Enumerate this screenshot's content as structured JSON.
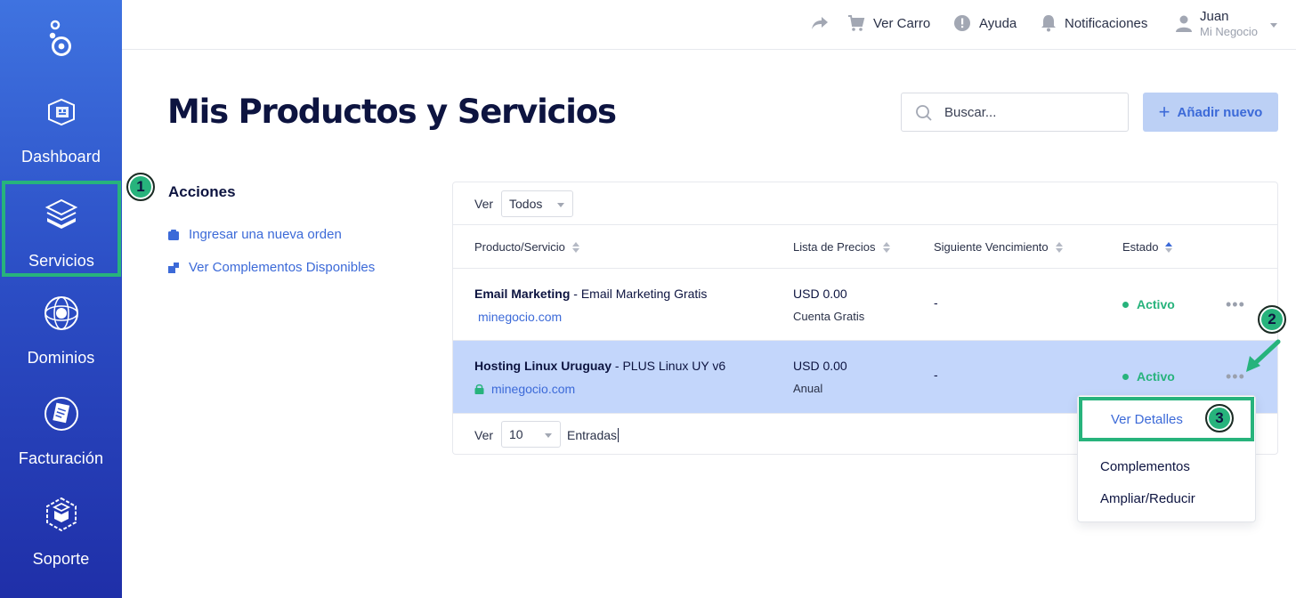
{
  "sidebar": {
    "items": [
      {
        "label": "Dashboard"
      },
      {
        "label": "Servicios"
      },
      {
        "label": "Dominios"
      },
      {
        "label": "Facturación"
      },
      {
        "label": "Soporte"
      }
    ]
  },
  "topbar": {
    "cart_label": "Ver Carro",
    "help_label": "Ayuda",
    "notifications_label": "Notificaciones",
    "user_name": "Juan",
    "user_business": "Mi Negocio"
  },
  "page": {
    "title": "Mis Productos y Servicios",
    "search_placeholder": "Buscar...",
    "add_label": "Añadir nuevo"
  },
  "markers": {
    "one": "1",
    "two": "2",
    "three": "3"
  },
  "actions": {
    "title": "Acciones",
    "links": [
      {
        "label": "Ingresar una nueva orden"
      },
      {
        "label": "Ver Complementos Disponibles"
      }
    ]
  },
  "table": {
    "filter_label": "Ver",
    "filter_value": "Todos",
    "columns": [
      "Producto/Servicio",
      "Lista de Precios",
      "Siguiente Vencimiento",
      "Estado"
    ],
    "rows": [
      {
        "product": "Email Marketing",
        "plan": " - Email Marketing Gratis",
        "domain": "minegocio.com",
        "price": "USD 0.00",
        "cycle": "Cuenta Gratis",
        "due": "-",
        "status": "Activo"
      },
      {
        "product": "Hosting Linux Uruguay",
        "plan": " - PLUS Linux UY v6",
        "domain": "minegocio.com",
        "price": "USD 0.00",
        "cycle": "Anual",
        "due": "-",
        "status": "Activo"
      }
    ],
    "footer_label": "Ver",
    "page_size": "10",
    "entries_label": "Entradas"
  },
  "dropdown": {
    "items": [
      {
        "label": "Ver Detalles"
      },
      {
        "label": "Complementos"
      },
      {
        "label": "Ampliar/Reducir"
      }
    ]
  },
  "colors": {
    "accent": "#3c6ad8",
    "success": "#27b37c",
    "highlight_row": "#c3d6fb",
    "sidebar_top": "#3f73e0",
    "sidebar_bottom": "#1f2fa8"
  }
}
